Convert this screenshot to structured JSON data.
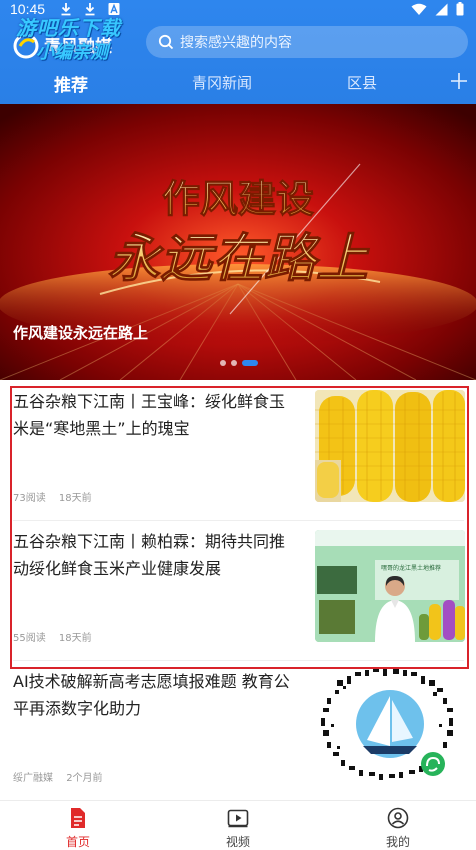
{
  "status_bar": {
    "time": "10:45"
  },
  "header": {
    "logo_text": "青风融媒",
    "watermark_line1": "游吧乐下载",
    "watermark_line2": "小编亲测",
    "search_placeholder": "搜索感兴趣的内容"
  },
  "tabs": [
    {
      "label": "推荐",
      "active": true
    },
    {
      "label": "青冈新闻",
      "active": false
    },
    {
      "label": "区县",
      "active": false
    }
  ],
  "banner": {
    "headline_line1": "作风建设",
    "headline_line2": "永远在路上",
    "caption": "作风建设永远在路上",
    "slide_count": 3,
    "active_slide": 3
  },
  "news": [
    {
      "title": "五谷杂粮下江南丨王宝峰：绥化鲜食玉米是“寒地黑土”上的瑰宝",
      "reads": "73阅读",
      "time": "18天前"
    },
    {
      "title": "五谷杂粮下江南丨赖柏霖：期待共同推动绥化鲜食玉米产业健康发展",
      "reads": "55阅读",
      "time": "18天前",
      "thumb_caption": "嘿哥的龙江黑土地推荐"
    },
    {
      "title": "AI技术破解新高考志愿填报难题 教育公平再添数字化助力",
      "reads": "绥广融媒",
      "time": "2个月前"
    }
  ],
  "bottom_nav": [
    {
      "label": "首页",
      "icon": "home-doc-icon",
      "active": true
    },
    {
      "label": "视频",
      "icon": "video-icon",
      "active": false
    },
    {
      "label": "我的",
      "icon": "profile-icon",
      "active": false
    }
  ],
  "colors": {
    "header_blue": "#2e86ee",
    "accent_red": "#e02a2a",
    "highlight_border": "#d9232a"
  }
}
